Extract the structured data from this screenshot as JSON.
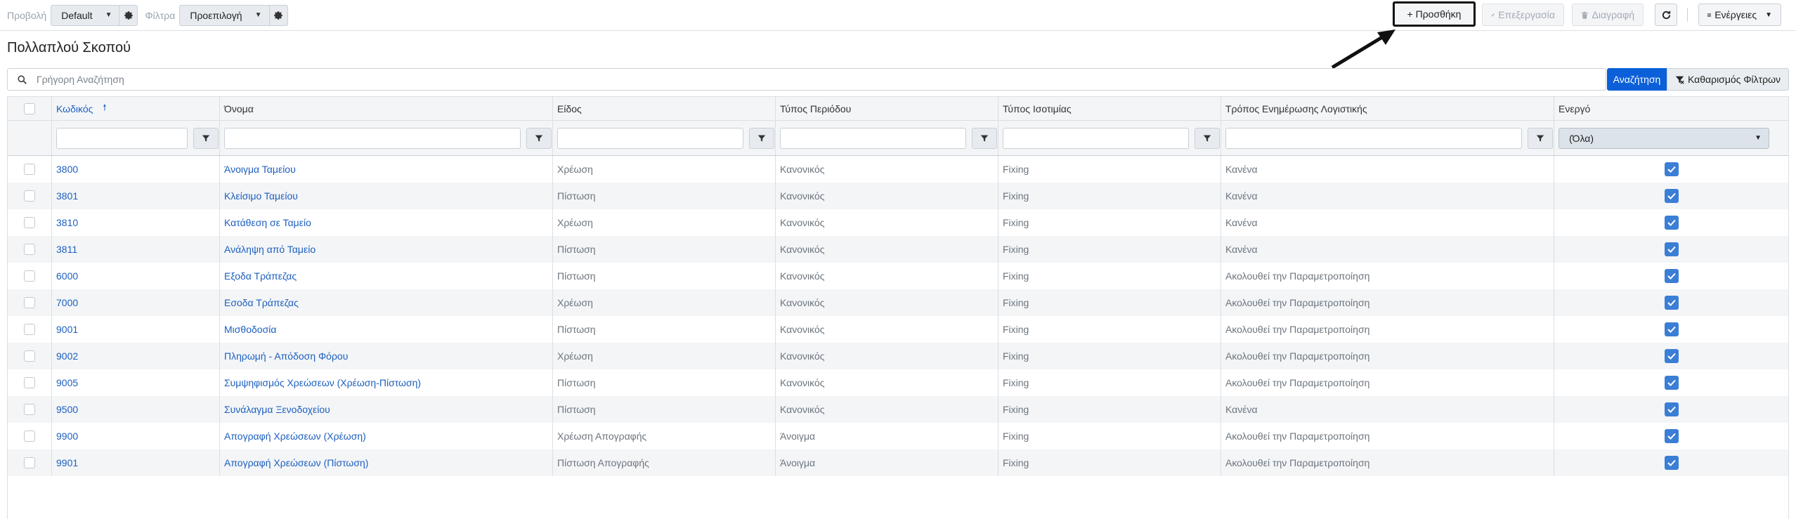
{
  "toolbar": {
    "view_label": "Προβολή",
    "view_value": "Default",
    "filters_label": "Φίλτρα",
    "filters_value": "Προεπιλογή",
    "add_label": "+ Προσθήκη",
    "edit_label": "Επεξεργασία",
    "delete_label": "Διαγραφή",
    "actions_label": "Ενέργειες"
  },
  "page_title": "Πολλαπλού Σκοπού",
  "search": {
    "placeholder": "Γρήγορη Αναζήτηση",
    "search_button": "Αναζήτηση",
    "clear_button": "Καθαρισμός Φίλτρων"
  },
  "grid": {
    "columns": [
      "Κωδικός",
      "Όνομα",
      "Είδος",
      "Τύπος Περιόδου",
      "Τύπος Ισοτιμίας",
      "Τρόπος Ενημέρωσης Λογιστικής",
      "Ενεργό"
    ],
    "active_filter_value": "(Όλα)",
    "rows": [
      {
        "code": "3800",
        "name": "Άνοιγμα Ταμείου",
        "kind": "Χρέωση",
        "period": "Κανονικός",
        "rate": "Fixing",
        "accounting": "Κανένα",
        "active": true
      },
      {
        "code": "3801",
        "name": "Κλείσιμο Ταμείου",
        "kind": "Πίστωση",
        "period": "Κανονικός",
        "rate": "Fixing",
        "accounting": "Κανένα",
        "active": true
      },
      {
        "code": "3810",
        "name": "Κατάθεση σε Ταμείο",
        "kind": "Χρέωση",
        "period": "Κανονικός",
        "rate": "Fixing",
        "accounting": "Κανένα",
        "active": true
      },
      {
        "code": "3811",
        "name": "Ανάληψη από Ταμείο",
        "kind": "Πίστωση",
        "period": "Κανονικός",
        "rate": "Fixing",
        "accounting": "Κανένα",
        "active": true
      },
      {
        "code": "6000",
        "name": "Εξοδα Τράπεζας",
        "kind": "Πίστωση",
        "period": "Κανονικός",
        "rate": "Fixing",
        "accounting": "Ακολουθεί την Παραμετροποίηση",
        "active": true
      },
      {
        "code": "7000",
        "name": "Εσοδα Τράπεζας",
        "kind": "Χρέωση",
        "period": "Κανονικός",
        "rate": "Fixing",
        "accounting": "Ακολουθεί την Παραμετροποίηση",
        "active": true
      },
      {
        "code": "9001",
        "name": "Μισθοδοσία",
        "kind": "Πίστωση",
        "period": "Κανονικός",
        "rate": "Fixing",
        "accounting": "Ακολουθεί την Παραμετροποίηση",
        "active": true
      },
      {
        "code": "9002",
        "name": "Πληρωμή - Απόδοση Φόρου",
        "kind": "Χρέωση",
        "period": "Κανονικός",
        "rate": "Fixing",
        "accounting": "Ακολουθεί την Παραμετροποίηση",
        "active": true
      },
      {
        "code": "9005",
        "name": "Συμψηφισμός Χρεώσεων (Χρέωση-Πίστωση)",
        "kind": "Πίστωση",
        "period": "Κανονικός",
        "rate": "Fixing",
        "accounting": "Ακολουθεί την Παραμετροποίηση",
        "active": true
      },
      {
        "code": "9500",
        "name": "Συνάλαγμα Ξενοδοχείου",
        "kind": "Πίστωση",
        "period": "Κανονικός",
        "rate": "Fixing",
        "accounting": "Κανένα",
        "active": true
      },
      {
        "code": "9900",
        "name": "Απογραφή Χρεώσεων (Χρέωση)",
        "kind": "Χρέωση Απογραφής",
        "period": "Άνοιγμα",
        "rate": "Fixing",
        "accounting": "Ακολουθεί την Παραμετροποίηση",
        "active": true
      },
      {
        "code": "9901",
        "name": "Απογραφή Χρεώσεων (Πίστωση)",
        "kind": "Πίστωση Απογραφής",
        "period": "Άνοιγμα",
        "rate": "Fixing",
        "accounting": "Ακολουθεί την Παραμετροποίηση",
        "active": true
      }
    ]
  },
  "icons": {
    "gear": "gear-icon",
    "pencil": "pencil-icon",
    "trash": "trash-icon",
    "refresh": "refresh-icon",
    "menu": "hamburger-icon",
    "search": "search-icon",
    "filter": "filter-icon",
    "check": "check-icon",
    "sort": "sort-ascending-icon"
  },
  "colors": {
    "primary": "#0b5fd8",
    "link": "#1d5fbf",
    "checkbox": "#3b7ed6"
  }
}
